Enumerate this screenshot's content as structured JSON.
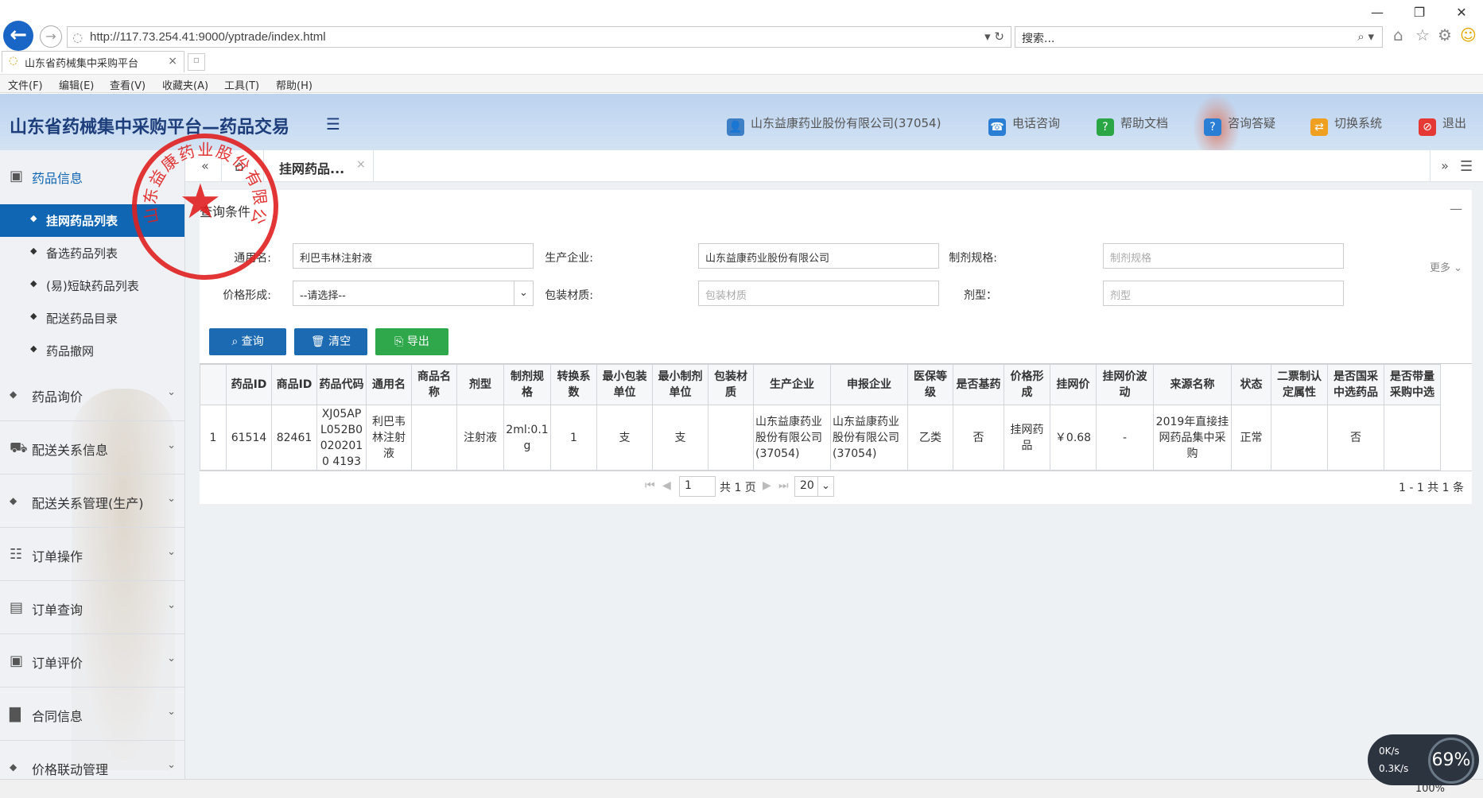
{
  "browser": {
    "url": "http://117.73.254.41:9000/yptrade/index.html",
    "search_placeholder": "搜索...",
    "tab_title": "山东省药械集中采购平台",
    "menu": [
      "文件(F)",
      "编辑(E)",
      "查看(V)",
      "收藏夹(A)",
      "工具(T)",
      "帮助(H)"
    ],
    "zoom": "100%"
  },
  "header": {
    "title": "山东省药械集中采购平台—药品交易",
    "company": "山东益康药业股份有限公司(37054)",
    "phone": "电话咨询",
    "help": "帮助文档",
    "consult": "咨询答疑",
    "switch": "切换系统",
    "logout": "退出"
  },
  "sidebar": {
    "groups": [
      {
        "label": "药品信息",
        "icon": "briefcase-icon"
      },
      {
        "label": "药品询价",
        "icon": "diamond-icon"
      },
      {
        "label": "配送关系信息",
        "icon": "truck-icon"
      },
      {
        "label": "配送关系管理(生产)",
        "icon": "diamond-icon"
      },
      {
        "label": "订单操作",
        "icon": "list-icon"
      },
      {
        "label": "订单查询",
        "icon": "search-doc-icon"
      },
      {
        "label": "订单评价",
        "icon": "briefcase-icon"
      },
      {
        "label": "合同信息",
        "icon": "book-icon"
      },
      {
        "label": "价格联动管理",
        "icon": "diamond-icon"
      }
    ],
    "subitems": [
      "挂网药品列表",
      "备选药品列表",
      "(易)短缺药品列表",
      "配送药品目录",
      "药品撤网"
    ]
  },
  "tabs": {
    "current": "挂网药品..."
  },
  "query": {
    "title": "查询条件",
    "more": "更多",
    "fields": {
      "generic_name_label": "通用名:",
      "generic_name_value": "利巴韦林注射液",
      "manufacturer_label": "生产企业:",
      "manufacturer_value": "山东益康药业股份有限公司",
      "spec_label": "制剂规格:",
      "spec_placeholder": "制剂规格",
      "price_form_label": "价格形成:",
      "price_form_value": "--请选择--",
      "package_label": "包装材质:",
      "package_placeholder": "包装材质",
      "dosage_label": "剂型：",
      "dosage_placeholder": "剂型"
    },
    "buttons": {
      "query": "查询",
      "clear": "清空",
      "export": "导出"
    }
  },
  "table": {
    "headers": [
      "",
      "药品ID",
      "商品ID",
      "药品代码",
      "通用名",
      "商品名称",
      "剂型",
      "制剂规格",
      "转换系数",
      "最小包装单位",
      "最小制剂单位",
      "包装材质",
      "生产企业",
      "申报企业",
      "医保等级",
      "是否基药",
      "价格形成",
      "挂网价",
      "挂网价波动",
      "来源名称",
      "状态",
      "二票制认定属性",
      "是否国采中选药品",
      "是否带量采购中选"
    ],
    "rows": [
      [
        "1",
        "61514",
        "82461",
        "XJ05APL052B00202010 4193",
        "利巴韦林注射液",
        "",
        "注射液",
        "2ml:0.1g",
        "1",
        "支",
        "支",
        "",
        "山东益康药业股份有限公司(37054)",
        "山东益康药业股份有限公司(37054)",
        "乙类",
        "否",
        "挂网药品",
        "￥0.68",
        "-",
        "2019年直接挂网药品集中采购",
        "正常",
        "",
        "否",
        ""
      ]
    ]
  },
  "pager": {
    "page": "1",
    "total_pages": "共 1 页",
    "page_size": "20",
    "summary": "1 - 1   共 1 条"
  },
  "stamp": {
    "text": "山东益康药业股份有限公司"
  },
  "net": {
    "up": "0K/s",
    "down": "0.3K/s",
    "percent": "69%"
  }
}
